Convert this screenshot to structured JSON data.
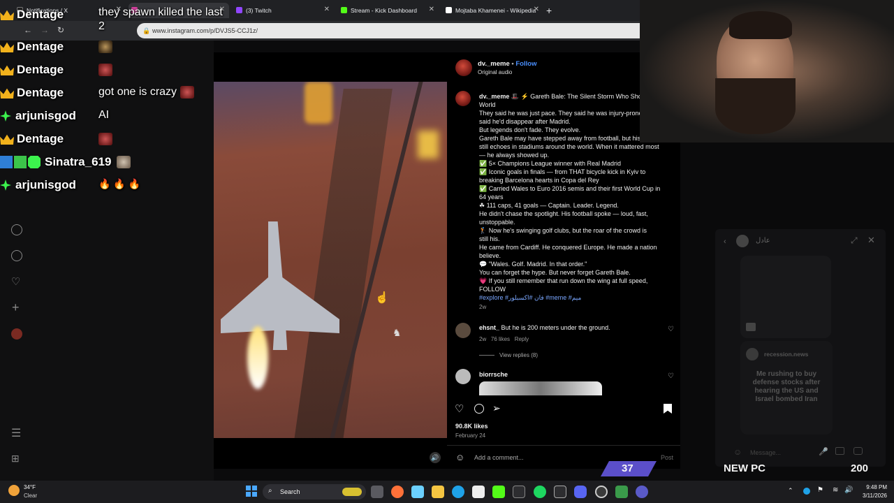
{
  "browser": {
    "tabs": [
      {
        "label": "Notifications / X"
      },
      {
        "label": ""
      },
      {
        "label": "(3) Twitch"
      },
      {
        "label": "Stream - Kick Dashboard"
      },
      {
        "label": "Mojtaba Khamenei - Wikipedia"
      }
    ],
    "url": "www.instagram.com/p/DVJS5-CCJ1z/",
    "new_tab": "+"
  },
  "chat": [
    {
      "user": "Dentage",
      "badge": "crown",
      "message": "they spawn killed the last 2",
      "emote": false
    },
    {
      "user": "Dentage",
      "badge": "crown",
      "message": "",
      "emote": true
    },
    {
      "user": "Dentage",
      "badge": "crown",
      "message": "",
      "emote": true
    },
    {
      "user": "Dentage",
      "badge": "crown",
      "message": "got one is crazy",
      "emote": true
    },
    {
      "user": "arjunisgod",
      "badge": "sparkle",
      "message": "AI",
      "emote": false
    },
    {
      "user": "Dentage",
      "badge": "crown",
      "message": "",
      "emote": true
    },
    {
      "user": "Sinatra_619",
      "badge": "multi",
      "message": "",
      "emote": true
    },
    {
      "user": "arjunisgod",
      "badge": "sparkle",
      "message": "🔥 🔥 🔥",
      "emote": false
    }
  ],
  "post": {
    "author": "dv._meme",
    "dot": "•",
    "follow": "Follow",
    "audio": "Original audio",
    "caption_author": "dv._meme",
    "caption_lines": [
      "🎩 ⚡ Gareth Bale: The Silent Storm Who Shook the",
      "World",
      "They said he was just pace. They said he was injury-prone. They",
      "said he'd disappear after Madrid.",
      "But legends don't fade. They evolve.",
      "Gareth Bale may have stepped away from football, but his name",
      "still echoes in stadiums around the world. When it mattered most",
      "— he always showed up.",
      "✅ 5× Champions League winner with Real Madrid",
      "✅ Iconic goals in finals — from THAT bicycle kick in Kyiv to",
      "breaking Barcelona hearts in Copa del Rey",
      "✅ Carried Wales to Euro 2016 semis and their first World Cup in",
      "64 years",
      "☘ 111 caps, 41 goals — Captain. Leader. Legend.",
      "He didn't chase the spotlight. His football spoke — loud, fast,",
      "unstoppable.",
      "🏌 Now he's swinging golf clubs, but the roar of the crowd is",
      "still his.",
      "He came from Cardiff. He conquered Europe. He made a nation",
      "believe.",
      "💬 \"Wales. Golf. Madrid. In that order.\"",
      "You can forget the hype. But never forget Gareth Bale.",
      "💗 If you still remember that run down the wing at full speed,",
      "FOLLOW"
    ],
    "hashtags": "#explore #فان #اكسبلور #meme #ميم",
    "caption_age": "2w",
    "comments": [
      {
        "user": "ehsnt_",
        "text": "But he is 200 meters under the ground.",
        "age": "2w",
        "likes": "76 likes",
        "reply": "Reply",
        "view_replies": "View replies (8)"
      },
      {
        "user": "biorrsche",
        "text": ""
      }
    ],
    "likes": "90.8K likes",
    "date": "February 24",
    "add_comment": "Add a comment...",
    "post_button": "Post"
  },
  "dm": {
    "name": "عادل",
    "card_user": "recession.news",
    "card_text": "Me rushing to buy defense stocks after hearing the US and Israel bombed Iran",
    "message_placeholder": "Message..."
  },
  "stream_bar": {
    "left_count": "37",
    "title": "NEW PC",
    "right_count": "200"
  },
  "taskbar": {
    "weather_temp": "34°F",
    "weather_desc": "Clear",
    "search": "Search",
    "time": "9:48 PM",
    "date": "3/11/2026"
  },
  "colors": {
    "accent_blue": "#4a90ff",
    "crown": "#f2b21c",
    "sparkle": "#3cf24d",
    "stream_purple": "#5b4fc9"
  }
}
